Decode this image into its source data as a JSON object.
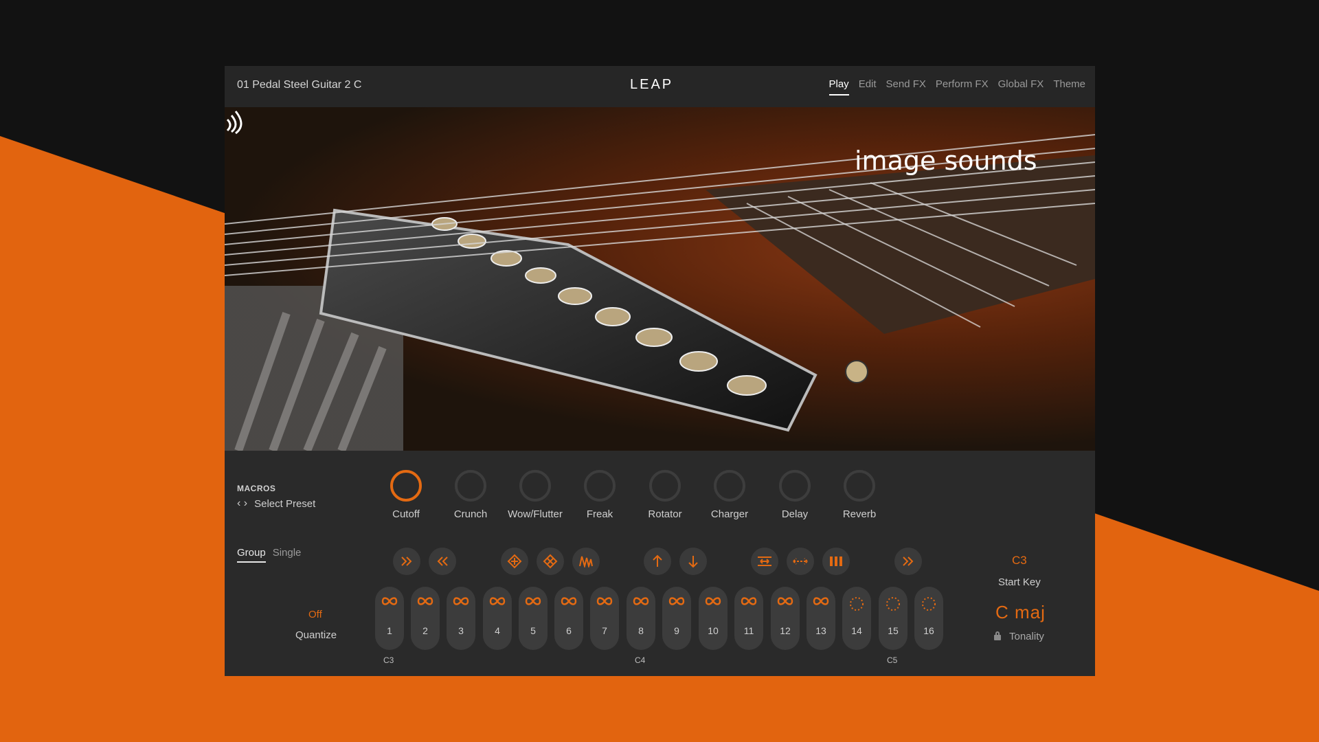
{
  "header": {
    "preset": "01 Pedal Steel Guitar 2 C",
    "logo": "LEAP",
    "tabs": [
      "Play",
      "Edit",
      "Send FX",
      "Perform FX",
      "Global FX",
      "Theme"
    ]
  },
  "hero": {
    "brand": "image sounds"
  },
  "macros": {
    "title": "MACROS",
    "select_preset": "Select Preset",
    "knobs": [
      "Cutoff",
      "Crunch",
      "Wow/Flutter",
      "Freak",
      "Rotator",
      "Charger",
      "Delay",
      "Reverb"
    ]
  },
  "mode_tabs": [
    "Group",
    "Single"
  ],
  "quantize": {
    "value": "Off",
    "label": "Quantize"
  },
  "pads": [
    "1",
    "2",
    "3",
    "4",
    "5",
    "6",
    "7",
    "8",
    "9",
    "10",
    "11",
    "12",
    "13",
    "14",
    "15",
    "16"
  ],
  "octaves": [
    "C3",
    "C4",
    "C5"
  ],
  "start_key": {
    "value": "C3",
    "label": "Start Key"
  },
  "tonality": {
    "value": "C  maj",
    "label": "Tonality"
  },
  "colors": {
    "accent": "#e46a12",
    "background_orange": "#e2640f",
    "panel": "#2a2a2a"
  },
  "icons": {
    "controls": [
      "fast-forward-icon",
      "rewind-icon",
      "shuffle-icon",
      "shuffle-alt-icon",
      "envelope-icon",
      "arrow-up-icon",
      "arrow-down-icon",
      "swap-icon",
      "expand-icon",
      "bars-icon",
      "fast-forward-icon"
    ]
  }
}
